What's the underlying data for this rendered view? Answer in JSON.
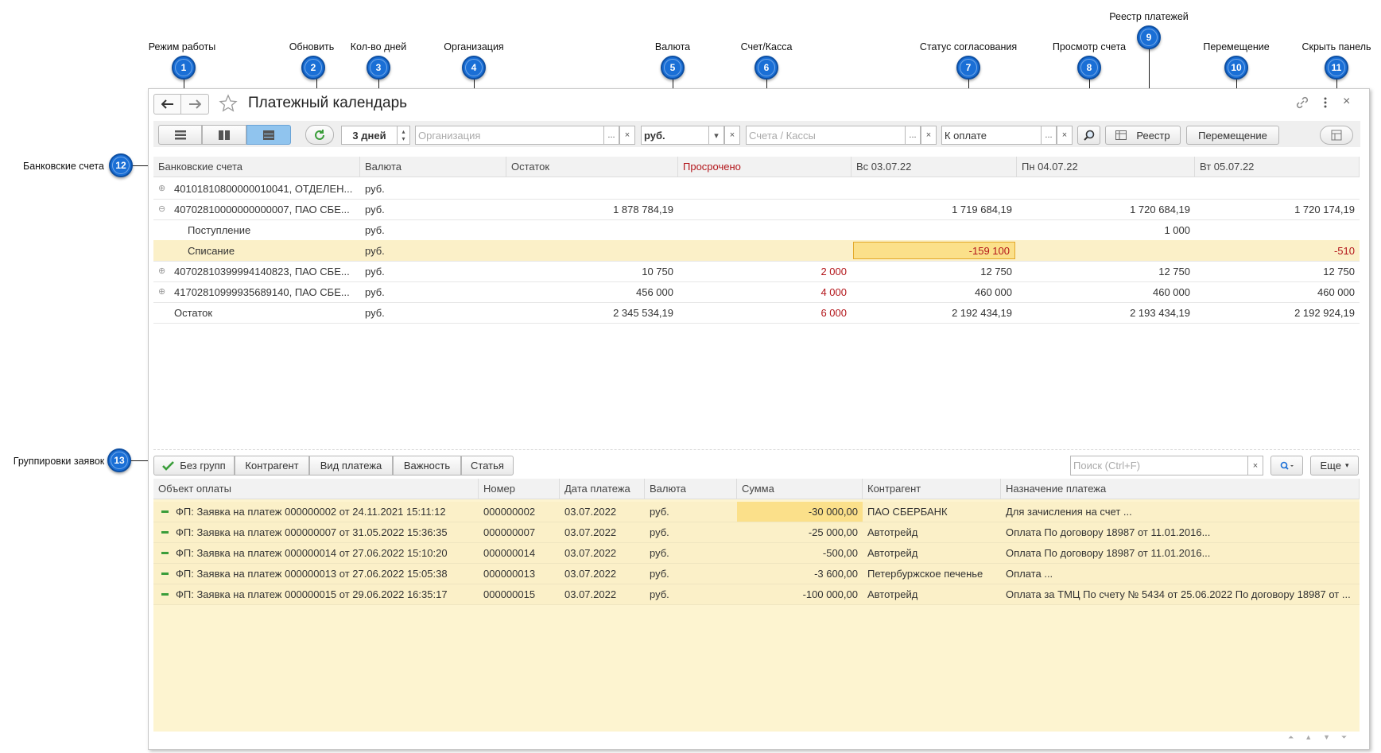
{
  "annotations": [
    {
      "num": "1",
      "label": "Режим работы"
    },
    {
      "num": "2",
      "label": "Обновить"
    },
    {
      "num": "3",
      "label": "Кол-во дней"
    },
    {
      "num": "4",
      "label": "Организация"
    },
    {
      "num": "5",
      "label": "Валюта"
    },
    {
      "num": "6",
      "label": "Счет/Касса"
    },
    {
      "num": "7",
      "label": "Статус согласования"
    },
    {
      "num": "8",
      "label": "Просмотр счета"
    },
    {
      "num": "9",
      "label": "Реестр платежей"
    },
    {
      "num": "10",
      "label": "Перемещение"
    },
    {
      "num": "11",
      "label": "Скрыть панель"
    },
    {
      "num": "12",
      "label": "Банковские счета"
    },
    {
      "num": "13",
      "label": "Группировки заявок"
    }
  ],
  "window": {
    "title": "Платежный календарь",
    "back_icon": "arrow-left-icon",
    "forward_icon": "arrow-right-icon",
    "favorite_icon": "star-icon"
  },
  "toolbar": {
    "days_value": "3 дней",
    "org_placeholder": "Организация",
    "currency_value": "руб.",
    "accounts_placeholder": "Счета / Кассы",
    "status_value": "К оплате",
    "registry_label": "Реестр",
    "transfer_label": "Перемещение",
    "ellipsis": "...",
    "clear": "×"
  },
  "accounts_table": {
    "headers": [
      "Банковские счета",
      "Валюта",
      "Остаток",
      "Просрочено",
      "Вс 03.07.22",
      "Пн 04.07.22",
      "Вт 05.07.22"
    ],
    "rows": [
      {
        "expand": "⊕",
        "name": "40101810800000010041, ОТДЕЛЕН...",
        "currency": "руб.",
        "balance": "",
        "overdue": "",
        "d1": "",
        "d2": "",
        "d3": ""
      },
      {
        "expand": "⊖",
        "name": "40702810000000000007, ПАО СБЕ...",
        "currency": "руб.",
        "balance": "1 878 784,19",
        "overdue": "",
        "d1": "1 719 684,19",
        "d2": "1 720 684,19",
        "d3": "1 720 174,19"
      },
      {
        "expand": "",
        "name": "Поступление",
        "currency": "руб.",
        "balance": "",
        "overdue": "",
        "d1": "",
        "d2": "1 000",
        "d3": ""
      },
      {
        "expand": "",
        "name": "Списание",
        "currency": "руб.",
        "balance": "",
        "overdue": "",
        "d1": "-159 100",
        "d2": "",
        "d3": "-510"
      },
      {
        "expand": "⊕",
        "name": "40702810399994140823, ПАО СБЕ...",
        "currency": "руб.",
        "balance": "10 750",
        "overdue": "2 000",
        "d1": "12 750",
        "d2": "12 750",
        "d3": "12 750"
      },
      {
        "expand": "⊕",
        "name": "41702810999935689140, ПАО СБЕ...",
        "currency": "руб.",
        "balance": "456 000",
        "overdue": "4 000",
        "d1": "460 000",
        "d2": "460 000",
        "d3": "460 000"
      },
      {
        "expand": "",
        "name": "Остаток",
        "currency": "руб.",
        "balance": "2 345 534,19",
        "overdue": "6 000",
        "d1": "2 192 434,19",
        "d2": "2 193 434,19",
        "d3": "2 192 924,19"
      }
    ]
  },
  "grouping_tabs": [
    "Без групп",
    "Контрагент",
    "Вид платежа",
    "Важность",
    "Статья"
  ],
  "search": {
    "placeholder": "Поиск (Ctrl+F)",
    "more_label": "Еще"
  },
  "requests_table": {
    "headers": [
      "Объект оплаты",
      "Номер",
      "Дата платежа",
      "Валюта",
      "Сумма",
      "Контрагент",
      "Назначение платежа"
    ],
    "rows": [
      {
        "object": "ФП: Заявка на платеж 000000002 от 24.11.2021 15:11:12",
        "number": "000000002",
        "date": "03.07.2022",
        "currency": "руб.",
        "sum": "-30 000,00",
        "counterparty": "ПАО СБЕРБАНК",
        "purpose": "Для зачисления на счет ..."
      },
      {
        "object": "ФП: Заявка на платеж 000000007 от 31.05.2022 15:36:35",
        "number": "000000007",
        "date": "03.07.2022",
        "currency": "руб.",
        "sum": "-25 000,00",
        "counterparty": "Автотрейд",
        "purpose": "Оплата По договору 18987 от 11.01.2016..."
      },
      {
        "object": "ФП: Заявка на платеж 000000014 от 27.06.2022 15:10:20",
        "number": "000000014",
        "date": "03.07.2022",
        "currency": "руб.",
        "sum": "-500,00",
        "counterparty": "Автотрейд",
        "purpose": "Оплата По договору 18987 от 11.01.2016..."
      },
      {
        "object": "ФП: Заявка на платеж 000000013 от 27.06.2022 15:05:38",
        "number": "000000013",
        "date": "03.07.2022",
        "currency": "руб.",
        "sum": "-3 600,00",
        "counterparty": "Петербуржское печенье",
        "purpose": "Оплата ..."
      },
      {
        "object": "ФП: Заявка на платеж 000000015 от 29.06.2022 16:35:17",
        "number": "000000015",
        "date": "03.07.2022",
        "currency": "руб.",
        "sum": "-100 000,00",
        "counterparty": "Автотрейд",
        "purpose": "Оплата за ТМЦ По счету № 5434 от 25.06.2022 По договору 18987 от ..."
      }
    ]
  },
  "colors": {
    "accent_blue": "#1a6fd6",
    "highlight_row": "#fbf0c8",
    "highlight_cell": "#fbe08a",
    "overdue_red": "#b3161b",
    "req_bg": "#fdf4d0"
  }
}
